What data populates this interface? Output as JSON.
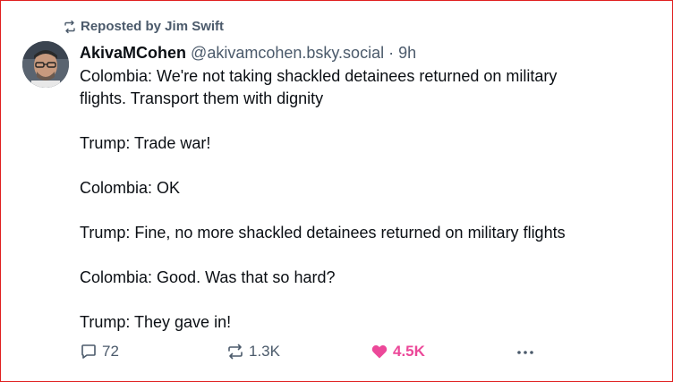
{
  "repost_banner": {
    "text": "Reposted by Jim Swift"
  },
  "post": {
    "author_name": "AkivaMCohen",
    "author_handle": "@akivamcohen.bsky.social",
    "separator": "·",
    "time": "9h",
    "lines": [
      "Colombia: We're not taking shackled detainees returned on military",
      "flights. Transport them with dignity",
      "",
      "Trump: Trade war!",
      "",
      "Colombia: OK",
      "",
      "Trump: Fine, no more shackled detainees returned on military flights",
      "",
      "Colombia: Good. Was that so hard?",
      "",
      "Trump: They gave in!"
    ]
  },
  "actions": {
    "reply_count": "72",
    "repost_count": "1.3K",
    "like_count": "4.5K",
    "like_color": "#ec4899"
  },
  "icons": {
    "repost_banner_icon": "repost-icon",
    "reply_icon": "comment-icon",
    "repost_icon": "repost-icon",
    "like_icon": "heart-icon",
    "more_icon": "more-icon"
  }
}
